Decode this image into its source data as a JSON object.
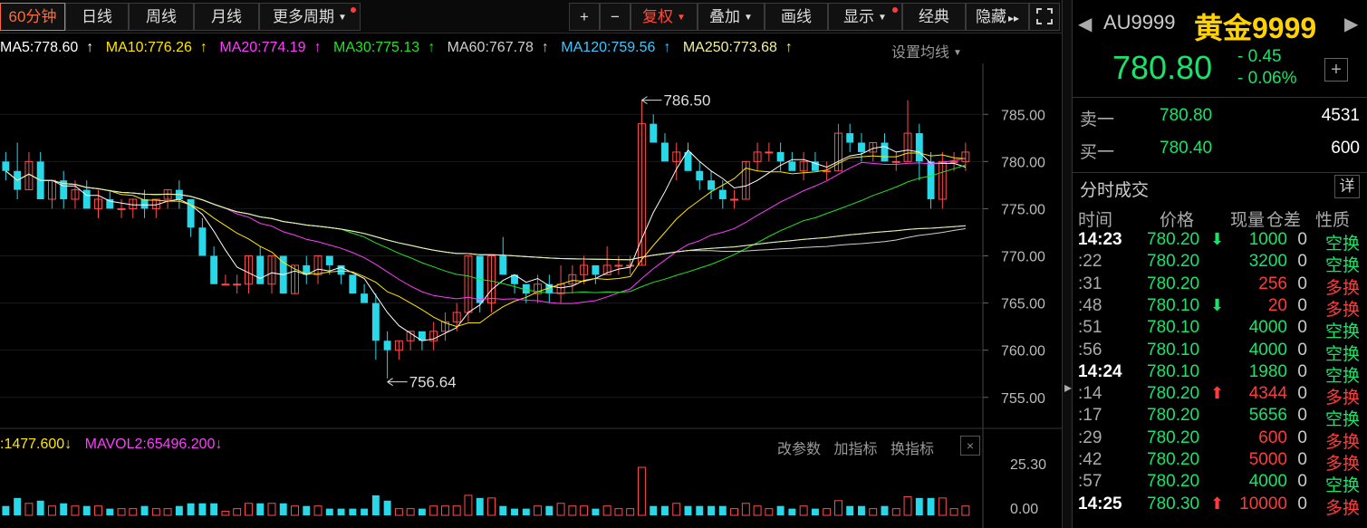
{
  "toolbar": {
    "period_60min": "60分钟",
    "daily": "日线",
    "weekly": "周线",
    "monthly": "月线",
    "more_periods": "更多周期",
    "zoom_in": "+",
    "zoom_out": "−",
    "restore_rights": "复权",
    "overlay": "叠加",
    "draw_line": "画线",
    "display": "显示",
    "classic": "经典",
    "hide": "隐藏",
    "expand_icon": "expand-icon"
  },
  "ma_legend": {
    "ma5": "MA5:778.60",
    "ma10": "MA10:776.26",
    "ma20": "MA20:774.19",
    "ma30": "MA30:775.13",
    "ma60": "MA60:767.78",
    "ma120": "MA120:759.56",
    "ma250": "MA250:773.68",
    "setting": "设置均线",
    "colors": {
      "ma5": "#ffffff",
      "ma10": "#ffe600",
      "ma20": "#ff3cff",
      "ma30": "#22e322",
      "ma60": "#cfcfcf",
      "ma120": "#3cc8ff",
      "ma250": "#f5f0a0"
    }
  },
  "volume": {
    "mavol1": ":1477.600",
    "mavol2": "MAVOL2:65496.200",
    "tools": [
      "改参数",
      "加指标",
      "换指标"
    ],
    "close": "×",
    "axis_top": "25.30",
    "axis_bottom": "0.00"
  },
  "chart_data": {
    "type": "candlestick",
    "price_axis_ticks": [
      "785.00",
      "780.00",
      "775.00",
      "770.00",
      "765.00",
      "760.00",
      "755.00"
    ],
    "ylim": [
      752.0,
      790.4
    ],
    "annotations": [
      {
        "label": "786.50",
        "value": 786.5
      },
      {
        "label": "756.64",
        "value": 756.64
      }
    ],
    "candles": [
      [
        780,
        781,
        778,
        779
      ],
      [
        779,
        782,
        776,
        777
      ],
      [
        777,
        781,
        777,
        780
      ],
      [
        780,
        781,
        776,
        776
      ],
      [
        776,
        778,
        775,
        778
      ],
      [
        778,
        779,
        775,
        776
      ],
      [
        776,
        778,
        775,
        777
      ],
      [
        777,
        778,
        775,
        775
      ],
      [
        775,
        777,
        774,
        776
      ],
      [
        776,
        777,
        775,
        775
      ],
      [
        775,
        776,
        774,
        775
      ],
      [
        775,
        776,
        774,
        776
      ],
      [
        776,
        777,
        774,
        775
      ],
      [
        775,
        776,
        774,
        776
      ],
      [
        776,
        777,
        775,
        777
      ],
      [
        777,
        778,
        775,
        776
      ],
      [
        776,
        776,
        772,
        773
      ],
      [
        773,
        774,
        770,
        770
      ],
      [
        770,
        771,
        767,
        767
      ],
      [
        767,
        768,
        767,
        767
      ],
      [
        767,
        768,
        766,
        767
      ],
      [
        767,
        770,
        766,
        770
      ],
      [
        770,
        771,
        767,
        767
      ],
      [
        767,
        770,
        766,
        770
      ],
      [
        770,
        770,
        766,
        766
      ],
      [
        766,
        769,
        766,
        769
      ],
      [
        769,
        770,
        767,
        768
      ],
      [
        768,
        770,
        767,
        770
      ],
      [
        770,
        770,
        768,
        769
      ],
      [
        769,
        769,
        767,
        768
      ],
      [
        768,
        768,
        766,
        766
      ],
      [
        766,
        767,
        765,
        765
      ],
      [
        765,
        766,
        759,
        761
      ],
      [
        761,
        762,
        757,
        760
      ],
      [
        760,
        761,
        759,
        761
      ],
      [
        761,
        762,
        760,
        762
      ],
      [
        762,
        762,
        760,
        761
      ],
      [
        761,
        763,
        760,
        762
      ],
      [
        762,
        764,
        761,
        763
      ],
      [
        763,
        765,
        762,
        764
      ],
      [
        764,
        770,
        763,
        770
      ],
      [
        770,
        770,
        764,
        765
      ],
      [
        765,
        770,
        764,
        770
      ],
      [
        770,
        772,
        769,
        768
      ],
      [
        768,
        768,
        766,
        767
      ],
      [
        767,
        767,
        765,
        766
      ],
      [
        766,
        768,
        765,
        767
      ],
      [
        767,
        768,
        765,
        766
      ],
      [
        766,
        769,
        765,
        767
      ],
      [
        767,
        769,
        766,
        768
      ],
      [
        768,
        770,
        767,
        769
      ],
      [
        769,
        769,
        767,
        768
      ],
      [
        768,
        771,
        768,
        769
      ],
      [
        769,
        770,
        768,
        769
      ],
      [
        769,
        770,
        768,
        769
      ],
      [
        769,
        786.5,
        769,
        784
      ],
      [
        784,
        785,
        782,
        782
      ],
      [
        782,
        783,
        780,
        780
      ],
      [
        780,
        782,
        778,
        781
      ],
      [
        781,
        782,
        779,
        779
      ],
      [
        779,
        780,
        777,
        778
      ],
      [
        778,
        779,
        776,
        777
      ],
      [
        777,
        778,
        775,
        776
      ],
      [
        776,
        777,
        775,
        776
      ],
      [
        776,
        780,
        776,
        780
      ],
      [
        780,
        782,
        779,
        781
      ],
      [
        781,
        782,
        780,
        781
      ],
      [
        781,
        782,
        779,
        780
      ],
      [
        780,
        781,
        779,
        779
      ],
      [
        779,
        781,
        778,
        780
      ],
      [
        780,
        781,
        779,
        779
      ],
      [
        779,
        780,
        778,
        779
      ],
      [
        779,
        784,
        779,
        783
      ],
      [
        783,
        784,
        781,
        782
      ],
      [
        782,
        783,
        780,
        781
      ],
      [
        781,
        782,
        780,
        782
      ],
      [
        782,
        783,
        780,
        780
      ],
      [
        780,
        781,
        779,
        780
      ],
      [
        780,
        786.5,
        780,
        783
      ],
      [
        783,
        784,
        778,
        780
      ],
      [
        780,
        781,
        775,
        776
      ],
      [
        776,
        781,
        775,
        780
      ],
      [
        780,
        781,
        779,
        780
      ],
      [
        780,
        782,
        779,
        781
      ]
    ]
  },
  "quote": {
    "code": "AU9999",
    "name": "黄金9999",
    "price": "780.80",
    "change": "- 0.45",
    "change_pct": "- 0.06%",
    "add_icon": "plus-icon"
  },
  "orderbook": {
    "sell1_label": "卖一",
    "sell1_price": "780.80",
    "sell1_qty": "4531",
    "buy1_label": "买一",
    "buy1_price": "780.40",
    "buy1_qty": "600"
  },
  "ticks": {
    "title": "分时成交",
    "detail": "详",
    "columns": [
      "时间",
      "价格",
      "现量",
      "仓差",
      "性质"
    ],
    "rows": [
      {
        "time": "14:23",
        "price": "780.20",
        "arrow": "⬇",
        "arrow_color": "green",
        "vol": "1000",
        "vol_color": "green",
        "oi": "0",
        "nature": "空换",
        "nature_color": "green"
      },
      {
        "time": ":22",
        "price": "780.20",
        "arrow": "",
        "arrow_color": "",
        "vol": "3200",
        "vol_color": "green",
        "oi": "0",
        "nature": "空换",
        "nature_color": "green"
      },
      {
        "time": ":31",
        "price": "780.20",
        "arrow": "",
        "arrow_color": "",
        "vol": "256",
        "vol_color": "red",
        "oi": "0",
        "nature": "多换",
        "nature_color": "red"
      },
      {
        "time": ":48",
        "price": "780.10",
        "arrow": "⬇",
        "arrow_color": "green",
        "vol": "20",
        "vol_color": "red",
        "oi": "0",
        "nature": "多换",
        "nature_color": "red"
      },
      {
        "time": ":51",
        "price": "780.10",
        "arrow": "",
        "arrow_color": "",
        "vol": "4000",
        "vol_color": "green",
        "oi": "0",
        "nature": "空换",
        "nature_color": "green"
      },
      {
        "time": ":56",
        "price": "780.10",
        "arrow": "",
        "arrow_color": "",
        "vol": "4000",
        "vol_color": "green",
        "oi": "0",
        "nature": "空换",
        "nature_color": "green"
      },
      {
        "time": "14:24",
        "price": "780.10",
        "arrow": "",
        "arrow_color": "",
        "vol": "1980",
        "vol_color": "green",
        "oi": "0",
        "nature": "空换",
        "nature_color": "green"
      },
      {
        "time": ":14",
        "price": "780.20",
        "arrow": "⬆",
        "arrow_color": "red",
        "vol": "4344",
        "vol_color": "red",
        "oi": "0",
        "nature": "多换",
        "nature_color": "red"
      },
      {
        "time": ":17",
        "price": "780.20",
        "arrow": "",
        "arrow_color": "",
        "vol": "5656",
        "vol_color": "green",
        "oi": "0",
        "nature": "空换",
        "nature_color": "green"
      },
      {
        "time": ":29",
        "price": "780.20",
        "arrow": "",
        "arrow_color": "",
        "vol": "600",
        "vol_color": "red",
        "oi": "0",
        "nature": "多换",
        "nature_color": "red"
      },
      {
        "time": ":42",
        "price": "780.20",
        "arrow": "",
        "arrow_color": "",
        "vol": "5000",
        "vol_color": "red",
        "oi": "0",
        "nature": "多换",
        "nature_color": "red"
      },
      {
        "time": ":57",
        "price": "780.20",
        "arrow": "",
        "arrow_color": "",
        "vol": "4000",
        "vol_color": "green",
        "oi": "0",
        "nature": "空换",
        "nature_color": "green"
      },
      {
        "time": "14:25",
        "price": "780.30",
        "arrow": "⬆",
        "arrow_color": "red",
        "vol": "10000",
        "vol_color": "red",
        "oi": "0",
        "nature": "多换",
        "nature_color": "red"
      }
    ]
  }
}
